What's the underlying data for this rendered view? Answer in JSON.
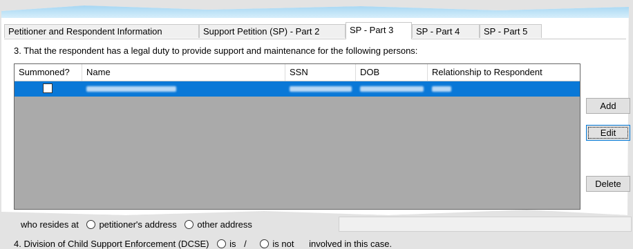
{
  "tabs": [
    {
      "label": "Petitioner and Respondent Information"
    },
    {
      "label": "Support Petition (SP) - Part 2"
    },
    {
      "label": "SP - Part 3"
    },
    {
      "label": "SP - Part 4"
    },
    {
      "label": "SP - Part 5"
    }
  ],
  "active_tab": "SP - Part 3",
  "question3": "3. That the respondent has a legal duty to provide support and maintenance for the following persons:",
  "grid": {
    "columns": [
      "Summoned?",
      "Name",
      "SSN",
      "DOB",
      "Relationship to Respondent"
    ],
    "rows": [
      {
        "summoned": false,
        "name": "",
        "ssn": "",
        "dob": "",
        "relationship": ""
      }
    ]
  },
  "buttons": {
    "add": "Add",
    "edit": "Edit",
    "delete": "Delete"
  },
  "resides": {
    "label": "who resides at",
    "option1": "petitioner's address",
    "option2": "other address"
  },
  "question4": {
    "prefix": "4. Division of Child Support Enforcement (DCSE)",
    "option_is": "is",
    "separator": "/",
    "option_is_not": "is not",
    "suffix": "involved in this case."
  }
}
